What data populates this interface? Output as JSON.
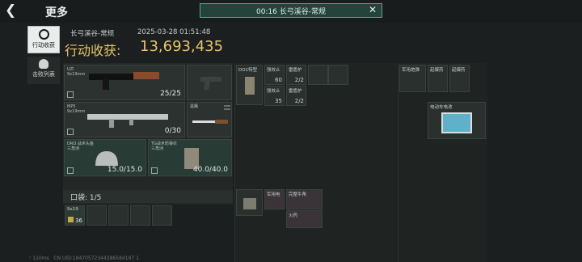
{
  "header": {
    "back_icon": "chevron-left-icon",
    "title": "更多"
  },
  "timer": {
    "text": "00:16  长弓溪谷-常规",
    "close_icon": "close-icon"
  },
  "sidebar": {
    "tabs": [
      {
        "label": "行动收获",
        "icon": "compass-icon"
      },
      {
        "label": "击败列表",
        "icon": "skull-icon"
      }
    ]
  },
  "summary": {
    "map": "长弓溪谷-常规",
    "datetime": "2025-03-28 01:51:48",
    "earnings_label": "行动收获:",
    "earnings_value": "13,693,435"
  },
  "loadout": {
    "primary": {
      "name": "UZI",
      "caliber": "9x19mm",
      "ammo": "25/25"
    },
    "secondary": {
      "name": "MP5",
      "caliber": "9x19mm",
      "ammo": "0/30"
    },
    "melee": {
      "name": "黑鹰"
    },
    "helmet": {
      "name": "DRO 战术头盔",
      "grade": "三角洲",
      "durability": "15.0/15.0"
    },
    "armor": {
      "name": "TG战术防弹衣",
      "grade": "三角洲",
      "durability": "40.0/40.0"
    }
  },
  "pocket": {
    "label": "口袋: 1/5",
    "item": {
      "name": "9x19",
      "count": "36"
    }
  },
  "chest": {
    "items": [
      {
        "name": "DO1特型",
        "count": ""
      },
      {
        "name": "强效止",
        "count": "60"
      },
      {
        "name": "雷盾护",
        "count": "2/2"
      },
      {
        "name": "强效止",
        "count": "35"
      },
      {
        "name": "雷盾护",
        "count": "2/2"
      }
    ]
  },
  "backpack": {
    "items": [
      {
        "name": "完整牛角"
      },
      {
        "name": "军用电"
      },
      {
        "name": "火药"
      }
    ]
  },
  "safebox": {
    "items": [
      {
        "name": "军用炮弹"
      },
      {
        "name": "起爆药"
      },
      {
        "name": "起爆药"
      },
      {
        "name": "电动车电池"
      }
    ]
  },
  "footer": {
    "ping": "110ms",
    "uid": "CN UID:18470572344386584197 1"
  }
}
